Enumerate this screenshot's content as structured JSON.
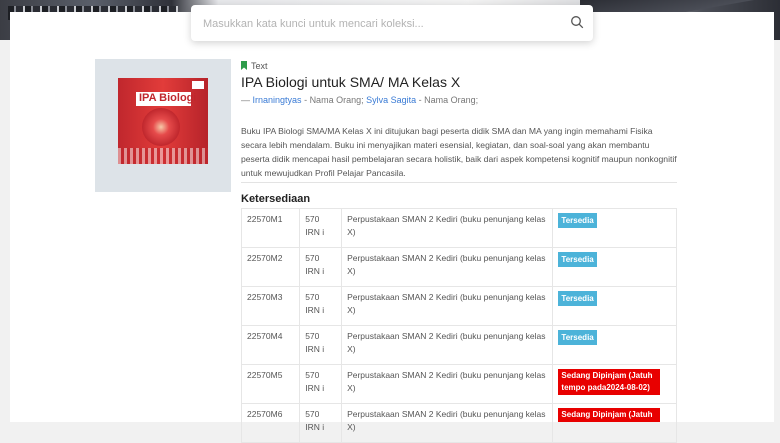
{
  "search": {
    "placeholder": "Masukkan kata kunci untuk mencari koleksi..."
  },
  "item": {
    "type": "Text",
    "title": "IPA Biologi untuk SMA/ MA Kelas X",
    "authors": [
      {
        "name": "Irnaningtyas",
        "role": "Nama Orang;"
      },
      {
        "name": "Sylva Sagita",
        "role": "Nama Orang;"
      }
    ],
    "author_prefix": "—",
    "description": "Buku IPA Biologi SMA/MA Kelas X ini ditujukan bagi peserta didik SMA dan MA yang ingin memahami Fisika secara lebih mendalam. Buku ini menyajikan materi esensial, kegiatan, dan soal-soal yang akan membantu peserta didik mencapai hasil pembelajaran secara holistik, baik dari aspek kompetensi kognitif maupun nonkognitif untuk mewujudkan Profil Pelajar Pancasila.",
    "cover_text": "IPA Biologi"
  },
  "availability": {
    "title": "Ketersediaan",
    "rows": [
      {
        "code": "22570M1",
        "call": "570 IRN i",
        "location": "Perpustakaan SMAN 2 Kediri (buku penunjang kelas X)",
        "status": "Tersedia",
        "status_type": "available"
      },
      {
        "code": "22570M2",
        "call": "570 IRN i",
        "location": "Perpustakaan SMAN 2 Kediri (buku penunjang kelas X)",
        "status": "Tersedia",
        "status_type": "available"
      },
      {
        "code": "22570M3",
        "call": "570 IRN i",
        "location": "Perpustakaan SMAN 2 Kediri (buku penunjang kelas X)",
        "status": "Tersedia",
        "status_type": "available"
      },
      {
        "code": "22570M4",
        "call": "570 IRN i",
        "location": "Perpustakaan SMAN 2 Kediri (buku penunjang kelas X)",
        "status": "Tersedia",
        "status_type": "available"
      },
      {
        "code": "22570M5",
        "call": "570 IRN i",
        "location": "Perpustakaan SMAN 2 Kediri (buku penunjang kelas X)",
        "status": "Sedang Dipinjam (Jatuh tempo pada2024-08-02)",
        "status_type": "loaned"
      },
      {
        "code": "22570M6",
        "call": "570 IRN i",
        "location": "Perpustakaan SMAN 2 Kediri (buku penunjang kelas X)",
        "status": "Sedang Dipinjam (Jatuh",
        "status_type": "loaned"
      }
    ]
  },
  "colors": {
    "available": "#4cb3d9",
    "loaned": "#e80000",
    "link": "#3a7bd5",
    "type_icon": "#2e9c4a"
  },
  "icons": {
    "search": "search-icon",
    "type": "bookmark-icon"
  }
}
